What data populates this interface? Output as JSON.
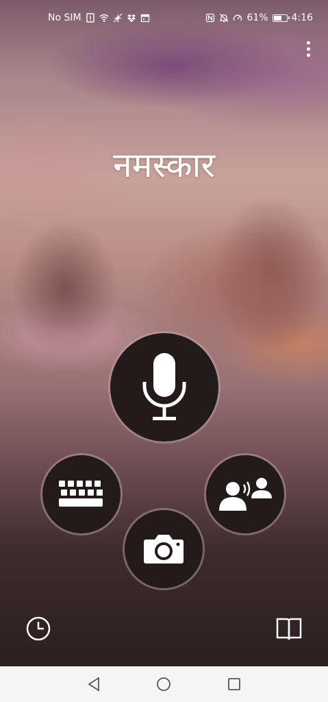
{
  "status_bar": {
    "carrier": "No SIM",
    "battery": "61%",
    "time": "4:16"
  },
  "main": {
    "greeting": "नमस्कार"
  },
  "actions": {
    "microphone": "microphone-icon",
    "keyboard": "keyboard-icon",
    "camera": "camera-icon",
    "conversation": "conversation-icon"
  },
  "bottom": {
    "history": "clock-icon",
    "phrasebook": "book-icon"
  },
  "colors": {
    "button_bg": "#231a1a",
    "navbar_bg": "#f5f5f5"
  }
}
